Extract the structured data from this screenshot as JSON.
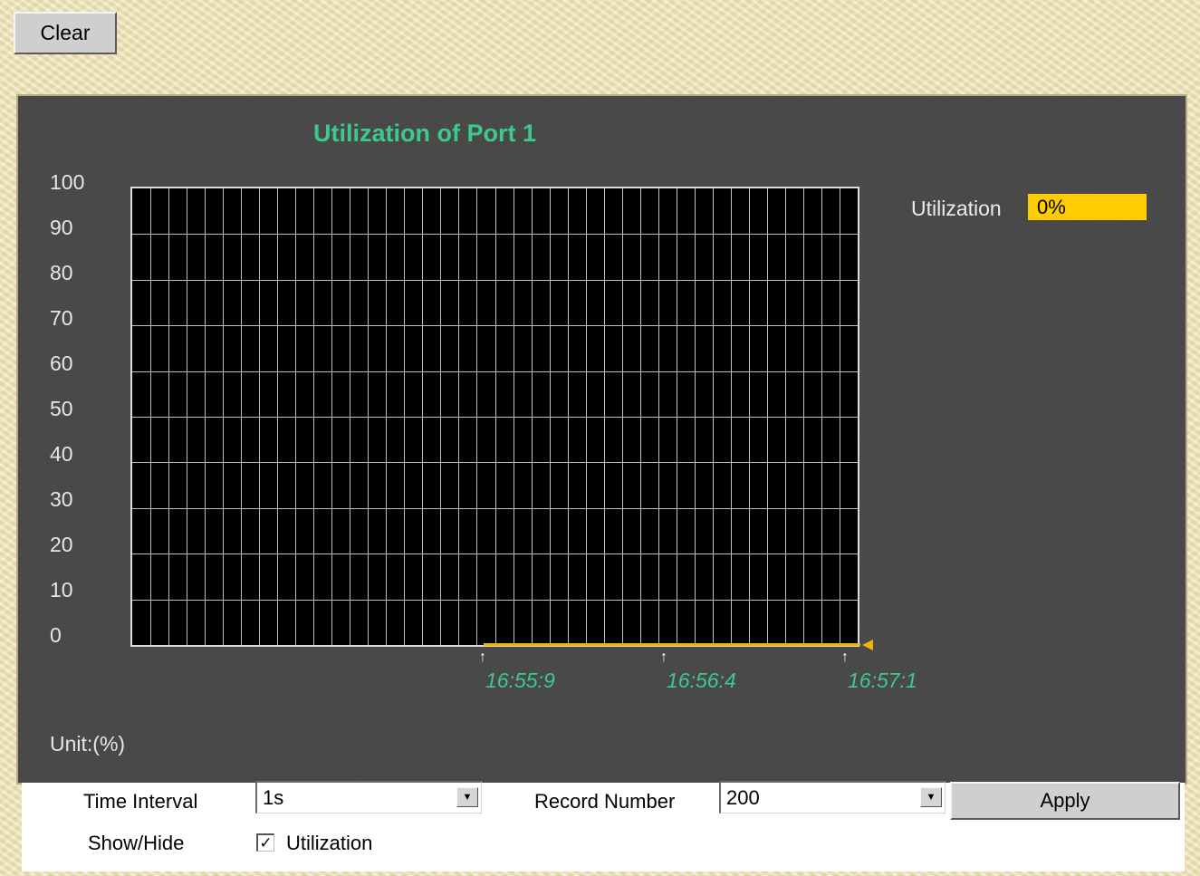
{
  "toolbar": {
    "clear_label": "Clear"
  },
  "chart_data": {
    "type": "line",
    "title": "Utilization of Port 1",
    "unit_label": "Unit:(%)",
    "ylim": [
      0,
      100
    ],
    "y_ticks": [
      "100",
      "90",
      "80",
      "70",
      "60",
      "50",
      "40",
      "30",
      "20",
      "10",
      "0"
    ],
    "x_ticks": [
      "16:55:9",
      "16:56:4",
      "16:57:1"
    ],
    "grid": true,
    "series": [
      {
        "name": "Utilization",
        "color": "#f0b400",
        "x": [
          "16:55:9",
          "16:56:4",
          "16:57:1"
        ],
        "values": [
          0,
          0,
          0
        ]
      }
    ]
  },
  "legend": {
    "label": "Utilization",
    "value": "0%",
    "color": "#ffcc00"
  },
  "controls": {
    "time_interval_label": "Time Interval",
    "time_interval_value": "1s",
    "record_number_label": "Record Number",
    "record_number_value": "200",
    "apply_label": "Apply",
    "show_hide_label": "Show/Hide",
    "utilization_checkbox_label": "Utilization",
    "utilization_checked": true
  }
}
